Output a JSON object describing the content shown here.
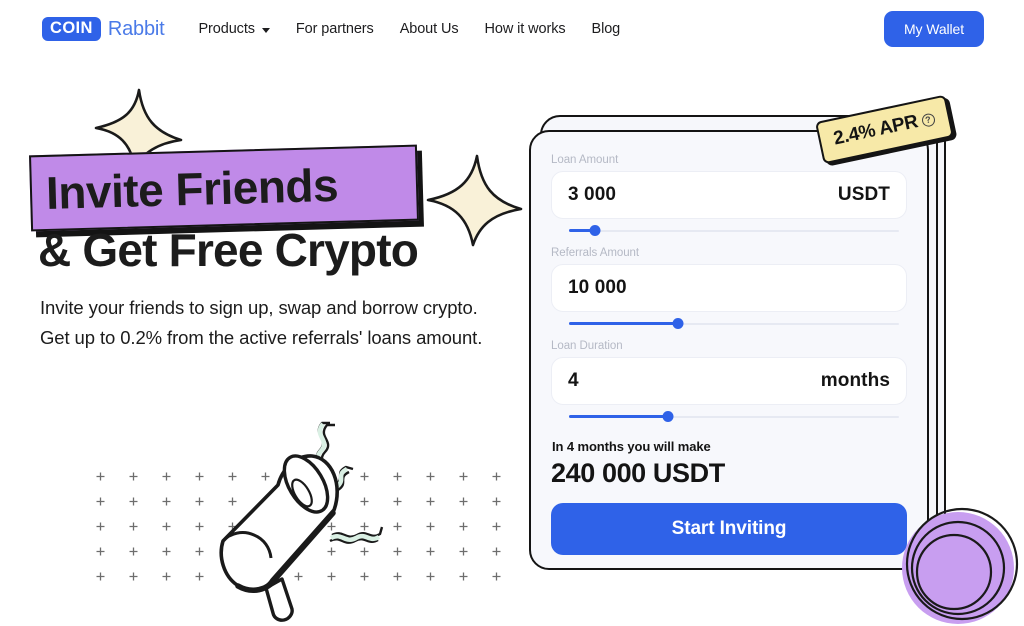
{
  "header": {
    "logo": {
      "badge": "COIN",
      "word": "Rabbit",
      "icon": "coinrabbit-logo"
    },
    "nav": [
      {
        "label": "Products",
        "has_dropdown": true,
        "icon": "chevron-down-icon"
      },
      {
        "label": "For partners",
        "has_dropdown": false
      },
      {
        "label": "About Us",
        "has_dropdown": false
      },
      {
        "label": "How it works",
        "has_dropdown": false
      },
      {
        "label": "Blog",
        "has_dropdown": false
      }
    ],
    "wallet_button": "My Wallet"
  },
  "hero": {
    "headline_line1": "Invite Friends",
    "headline_line2": "& Get Free Crypto",
    "subtext": "Invite your friends to sign up, swap and borrow crypto. Get up to 0.2% from the active referrals' loans amount.",
    "illustration": "megaphone-illustration",
    "sparkle_icon": "sparkle-star-icon"
  },
  "calculator": {
    "fields": [
      {
        "label": "Loan Amount",
        "value": "3 000",
        "unit": "USDT",
        "slider_percent": 8
      },
      {
        "label": "Referrals Amount",
        "value": "10 000",
        "unit": "",
        "slider_percent": 33
      },
      {
        "label": "Loan Duration",
        "value": "4",
        "unit": "months",
        "slider_percent": 30
      }
    ],
    "result_label": "In 4 months you will make",
    "result_value": "240 000 USDT",
    "cta_label": "Start Inviting"
  },
  "apr_badge": {
    "text": "2.4% APR",
    "help_icon": "question-mark-icon"
  },
  "colors": {
    "brand_blue": "#2f62e8",
    "banner_purple": "#c08ae8",
    "badge_yellow": "#f7e9a8",
    "sparkle_cream": "#f9f1d8",
    "outline_black": "#141414",
    "card_bg": "#f7f8fc",
    "label_gray": "#b5b9c5",
    "wave_mint": "#daf0e4",
    "circle_purple": "#c89ef0"
  }
}
